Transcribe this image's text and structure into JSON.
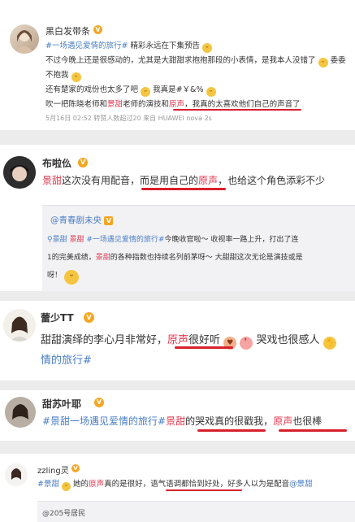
{
  "c1": {
    "user": "黑白发带条",
    "vip": "V",
    "l1_tag": "#一场遇见爱情的旅行#",
    "l1_text": " 精彩永远在下集预告",
    "l2": "不过今晚上还是很感动的，尤其是大甜甜求抱抱那段的小表情，是我本人没错了",
    "l2_tail": "委委",
    "l3": "不抱我",
    "l4": "还有楚家的戏份也太多了吧",
    "l4b": "我真是#￥&%",
    "l5a": "吹一把陈晓老师和",
    "l5b": "景甜",
    "l5c": "老师的演技和",
    "l5d": "原声",
    "l5e": "，我真的太喜欢他们自己的声音了",
    "meta": "5月16日 02:52 转赞人数超过20 来自 HUAWEI nova 2s"
  },
  "c2": {
    "user": "布啦仫",
    "vip": "V",
    "t1": "景甜",
    "t2": "这次没有用配音，",
    "t3": "而是用自己的",
    "t4": "原声",
    "t5": "，也给这个角色添彩不少",
    "q_user": "@青春剧未央",
    "q_badge": "V",
    "q1_a": "景甜",
    "q1_b": "景甜",
    "q1_c": "#一场遇见爱情的旅行#",
    "q1_d": "今晚收官啦～ 收视率一路上升，打出了连",
    "q2_a": "1的完美成绩，",
    "q2_b": "景甜",
    "q2_c": "的各种指数也持续名列前茅呀～ 大甜甜这次无论是演技或是",
    "q3": "呀！"
  },
  "c3": {
    "user": "蕾少TT",
    "vip": "V",
    "t1": "甜甜演绎的李心月非常好，",
    "t2": "原声",
    "t3": "很好听",
    "t4": "哭戏也很感人",
    "t5": "情的旅行#"
  },
  "c4": {
    "user": "甜苏叶耶",
    "vip": "V",
    "t1": "#景甜一场遇见爱情的旅行#",
    "t2": "景甜",
    "t3": "的",
    "t4": "哭戏真的很戳我",
    "t5": "，",
    "t6": "原声",
    "t7": "也很棒"
  },
  "c5": {
    "user": "zzling灵",
    "vip": "V",
    "t1": "#景甜",
    "t2": "她的",
    "t3": "原声",
    "t4": "真的是很好，",
    "t5": "语气语调都恰到好处",
    "t6": "，好多人以为是配音",
    "t7": "@景甜",
    "q_user": "@205号居民"
  }
}
